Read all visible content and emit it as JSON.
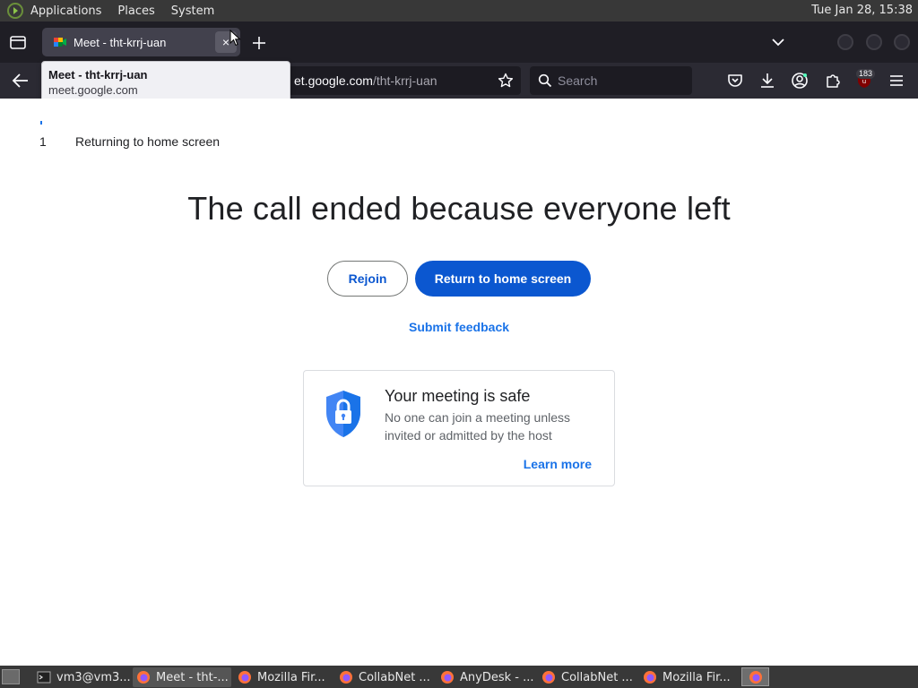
{
  "top_panel": {
    "menus": [
      "Applications",
      "Places",
      "System"
    ],
    "clock": "Tue Jan 28, 15:38"
  },
  "browser": {
    "tab": {
      "title": "Meet - tht-krrj-uan",
      "close_symbol": "×"
    },
    "tooltip": {
      "title": "Meet - tht-krrj-uan",
      "domain": "meet.google.com"
    },
    "urlbar": {
      "host_visible": "et.google.com",
      "path": "/tht-krrj-uan"
    },
    "search": {
      "placeholder": "Search"
    },
    "extension_badge": "183"
  },
  "page": {
    "countdown": "1",
    "redirect_text": "Returning to home screen",
    "headline": "The call ended because everyone left",
    "rejoin_label": "Rejoin",
    "home_label": "Return to home screen",
    "feedback_label": "Submit feedback",
    "safe_card": {
      "title": "Your meeting is safe",
      "text": "No one can join a meeting unless invited or admitted by the host",
      "learn_more": "Learn more"
    }
  },
  "taskbar": {
    "tasks": [
      {
        "label": "vm3@vm3...",
        "icon": "terminal-icon"
      },
      {
        "label": "Meet - tht-...",
        "icon": "firefox-icon"
      },
      {
        "label": "Mozilla Fir...",
        "icon": "firefox-icon"
      },
      {
        "label": "CollabNet ...",
        "icon": "firefox-icon"
      },
      {
        "label": "AnyDesk - ...",
        "icon": "firefox-icon"
      },
      {
        "label": "CollabNet ...",
        "icon": "firefox-icon"
      },
      {
        "label": "Mozilla Fir...",
        "icon": "firefox-icon"
      }
    ]
  },
  "colors": {
    "primary_button": "#0b57d0",
    "link": "#1a73e8",
    "shield": "#4285f4"
  }
}
